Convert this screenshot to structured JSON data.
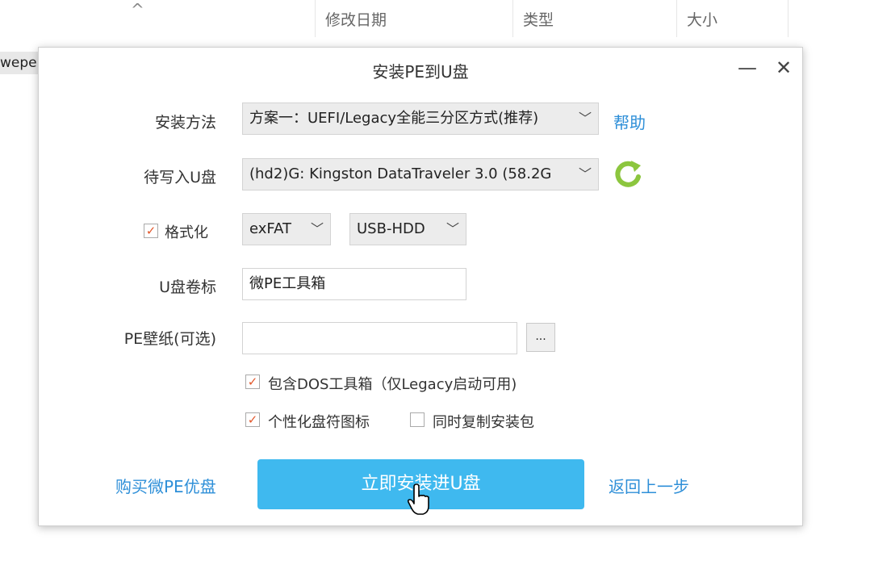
{
  "background": {
    "columns": [
      "修改日期",
      "类型",
      "大小"
    ],
    "row_fragment": "wepe"
  },
  "dialog": {
    "title": "安装PE到U盘",
    "minimize": "—",
    "close": "✕",
    "install_method": {
      "label": "安装方法",
      "value": "方案一：UEFI/Legacy全能三分区方式(推荐)",
      "help": "帮助"
    },
    "target_disk": {
      "label": "待写入U盘",
      "value": "(hd2)G: Kingston DataTraveler 3.0 (58.2G"
    },
    "format": {
      "label": "格式化",
      "checked": true,
      "fs": "exFAT",
      "mode": "USB-HDD"
    },
    "volume_label": {
      "label": "U盘卷标",
      "value": "微PE工具箱"
    },
    "wallpaper": {
      "label": "PE壁纸(可选)",
      "value": "",
      "browse": "..."
    },
    "options": [
      {
        "label": "包含DOS工具箱（仅Legacy启动可用)",
        "checked": true
      },
      {
        "label": "个性化盘符图标",
        "checked": true
      },
      {
        "label": "同时复制安装包",
        "checked": false
      }
    ],
    "buy_link": "购买微PE优盘",
    "install_button": "立即安装进U盘",
    "back_link": "返回上一步"
  },
  "colors": {
    "accent": "#3fb9ef",
    "link": "#2e8fd8",
    "check": "#e2572b",
    "refresh": "#8cc63e"
  }
}
